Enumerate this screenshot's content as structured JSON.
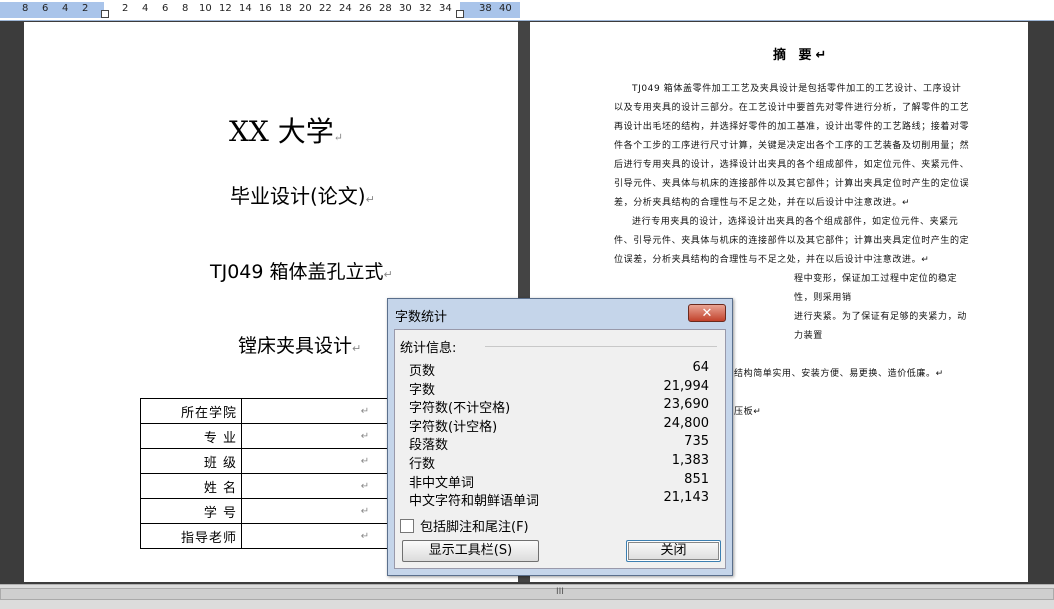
{
  "ruler": {
    "numbers": [
      "8",
      "6",
      "4",
      "2",
      "2",
      "4",
      "6",
      "8",
      "10",
      "12",
      "14",
      "16",
      "18",
      "20",
      "22",
      "24",
      "26",
      "28",
      "30",
      "32",
      "34",
      "38",
      "40"
    ]
  },
  "left_page": {
    "university": "XX 大学",
    "subtitle": "毕业设计(论文)",
    "topic_line1": "TJ049 箱体盖孔立式",
    "topic_line2": "镗床夹具设计",
    "mark": "↵",
    "info_rows": [
      {
        "label": "所在学院",
        "value": "↵"
      },
      {
        "label": "专    业",
        "value": "↵"
      },
      {
        "label": "班    级",
        "value": "↵"
      },
      {
        "label": "姓    名",
        "value": "↵"
      },
      {
        "label": "学    号",
        "value": "↵"
      },
      {
        "label": "指导老师",
        "value": "↵"
      }
    ]
  },
  "right_page": {
    "abstract_title": "摘 要↵",
    "paragraph1": "TJ049 箱体盖零件加工工艺及夹具设计是包括零件加工的工艺设计、工序设计以及专用夹具的设计三部分。在工艺设计中要首先对零件进行分析，了解零件的工艺再设计出毛坯的结构，并选择好零件的加工基准，设计出零件的工艺路线；接着对零件各个工步的工序进行尺寸计算，关键是决定出各个工序的工艺装备及切削用量；然后进行专用夹具的设计，选择设计出夹具的各个组成部件，如定位元件、夹紧元件、引导元件、夹具体与机床的连接部件以及其它部件；计算出夹具定位时产生的定位误差，分析夹具结构的合理性与不足之处，并在以后设计中注意改进。↵",
    "paragraph2": "进行专用夹具的设计，选择设计出夹具的各个组成部件，如定位元件、夹紧元件、引导元件、夹具体与机床的连接部件以及其它部件；计算出夹具定位时产生的定位误差，分析夹具结构的合理性与不足之处，并在以后设计中注意改进。↵",
    "line3_tail": "程中变形，保证加工过程中定位的稳定性，则采用销",
    "line4_tail": "进行夹紧。为了保证有足够的夹紧力，动力装置",
    "line5_tail": "结构简单实用、安装方便、易更换、造价低廉。↵",
    "line6_tail": "压板↵"
  },
  "dialog": {
    "title": "字数统计",
    "close_glyph": "✕",
    "section_label": "统计信息:",
    "stats": [
      {
        "key": "页数",
        "value": "64"
      },
      {
        "key": "字数",
        "value": "21,994"
      },
      {
        "key": "字符数(不计空格)",
        "value": "23,690"
      },
      {
        "key": "字符数(计空格)",
        "value": "24,800"
      },
      {
        "key": "段落数",
        "value": "735"
      },
      {
        "key": "行数",
        "value": "1,383"
      },
      {
        "key": "非中文单词",
        "value": "851"
      },
      {
        "key": "中文字符和朝鲜语单词",
        "value": "21,143"
      }
    ],
    "checkbox_label": "包括脚注和尾注(F)",
    "checkbox_checked": false,
    "toolbar_button": "显示工具栏(S)",
    "close_button": "关闭"
  },
  "scrollbar": {
    "grip": "III"
  }
}
